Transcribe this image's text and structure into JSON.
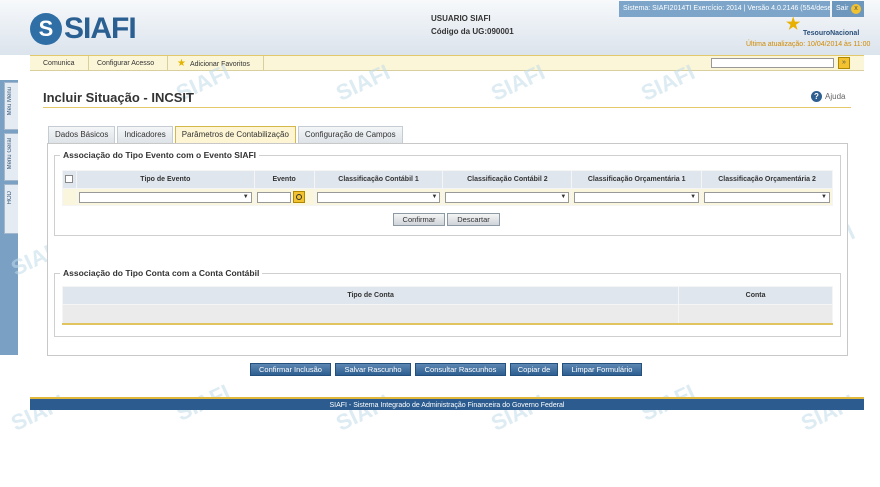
{
  "header": {
    "logo_text": "SIAFI",
    "logo_mark": "S",
    "user_label": "USUARIO SIAFI",
    "ug_label": "Código da UG:",
    "ug_code": "090001",
    "system_info": "Sistema: SIAFI2014TI Exercício: 2014 | Versão 4.0.2146 (554/desenv)",
    "exit_label": "Sair",
    "exit_icon": "x",
    "tesouro": "TesouroNacional",
    "last_update": "Última atualização: 10/04/2014 às 11:00"
  },
  "menu": {
    "items": [
      "Comunica",
      "Configurar Acesso",
      "Adicionar Favoritos"
    ],
    "search_placeholder": "",
    "search_go": "»"
  },
  "side": {
    "tabs": [
      "Meu Menu",
      "Menu Geral",
      "HOD"
    ]
  },
  "page": {
    "title": "Incluir Situação - INCSIT",
    "help": "Ajuda",
    "help_icon": "?"
  },
  "tabs": [
    "Dados Básicos",
    "Indicadores",
    "Parâmetros de Contabilização",
    "Configuração de Campos"
  ],
  "evento_section": {
    "legend": "Associação do Tipo Evento com o Evento SIAFI",
    "columns": [
      "Tipo de Evento",
      "Evento",
      "Classificação Contábil 1",
      "Classificação Contábil 2",
      "Classificação Orçamentária 1",
      "Classificação Orçamentária 2"
    ],
    "confirm_label": "Confirmar",
    "discard_label": "Descartar"
  },
  "conta_section": {
    "legend": "Associação do Tipo Conta com a Conta Contábil",
    "columns": [
      "Tipo de Conta",
      "Conta"
    ]
  },
  "actions": [
    "Confirmar Inclusão",
    "Salvar Rascunho",
    "Consultar Rascunhos",
    "Copiar de",
    "Limpar Formulário"
  ],
  "footer": "SIAFI - Sistema Integrado de Administração Financeira do Governo Federal",
  "watermark": "SIAFI",
  "colors": {
    "brand_blue": "#2c5c8f",
    "accent_yellow": "#f2c230",
    "active_tab": "#fdf5d3"
  }
}
